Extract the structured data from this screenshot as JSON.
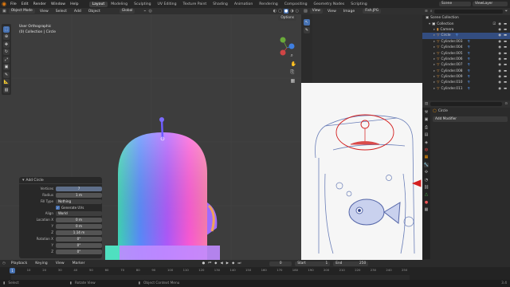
{
  "topbar": {
    "menus": [
      "File",
      "Edit",
      "Render",
      "Window",
      "Help"
    ],
    "workspaces": [
      "Layout",
      "Modeling",
      "Sculpting",
      "UV Editing",
      "Texture Paint",
      "Shading",
      "Animation",
      "Rendering",
      "Compositing",
      "Geometry Nodes",
      "Scripting"
    ],
    "active_workspace": "Layout",
    "scene": "Scene",
    "view_layer": "ViewLayer"
  },
  "viewport_header": {
    "mode": "Object Mode",
    "menus": [
      "View",
      "Select",
      "Add",
      "Object"
    ],
    "orientation": "Global",
    "options": "Options"
  },
  "viewport": {
    "view_name": "User Orthographic",
    "collection_path": "(0) Collection | Circle",
    "toolbar_icons": [
      "cursor-icon",
      "move-icon",
      "rotate-icon",
      "scale-icon",
      "transform-icon",
      "annotate-icon",
      "measure-icon",
      "add-cube-icon"
    ]
  },
  "operator_panel": {
    "title": "Add Circle",
    "vertices_label": "Vertices",
    "vertices": "7",
    "radius_label": "Radius",
    "radius": "1 m",
    "fill_type_label": "Fill Type",
    "fill_type": "Nothing",
    "generate_uvs": "Generate UVs",
    "align_label": "Align",
    "align": "World",
    "location_label": "Location X",
    "location": [
      "0 m",
      "0 m",
      "1.14 m"
    ],
    "rotation_label": "Rotation X",
    "rotation": [
      "0°",
      "0°",
      "0°"
    ],
    "axis_y": "Y",
    "axis_z": "Z"
  },
  "image_editor": {
    "menus": [
      "View",
      "View",
      "Image"
    ],
    "image_name": "Fish.JPG"
  },
  "outliner": {
    "root": "Scene Collection",
    "collection": "Collection",
    "items": [
      "Camera",
      "Circle",
      "Cylinder.003",
      "Cylinder.004",
      "Cylinder.005",
      "Cylinder.006",
      "Cylinder.007",
      "Cylinder.008",
      "Cylinder.009",
      "Cylinder.010",
      "Cylinder.011"
    ],
    "selected": "Circle"
  },
  "properties": {
    "object_name": "Circle",
    "add_modifier": "Add Modifier"
  },
  "timeline": {
    "menus": [
      "Playback",
      "Keying",
      "View",
      "Marker"
    ],
    "current_frame": "0",
    "start_label": "Start",
    "start": "1",
    "end_label": "End",
    "end": "250",
    "ticks": [
      "0",
      "10",
      "20",
      "30",
      "40",
      "50",
      "60",
      "70",
      "80",
      "90",
      "100",
      "110",
      "120",
      "130",
      "140",
      "150",
      "160",
      "170",
      "180",
      "190",
      "200",
      "210",
      "220",
      "230",
      "240",
      "250"
    ],
    "playhead": "1"
  },
  "statusbar": {
    "select": "Select",
    "rotate_view": "Rotate View",
    "context_menu": "Object Context Menu",
    "version": "3.4"
  },
  "colors": {
    "accent": "#4772b3",
    "selection": "#334d80",
    "annotation": "#d42020"
  }
}
